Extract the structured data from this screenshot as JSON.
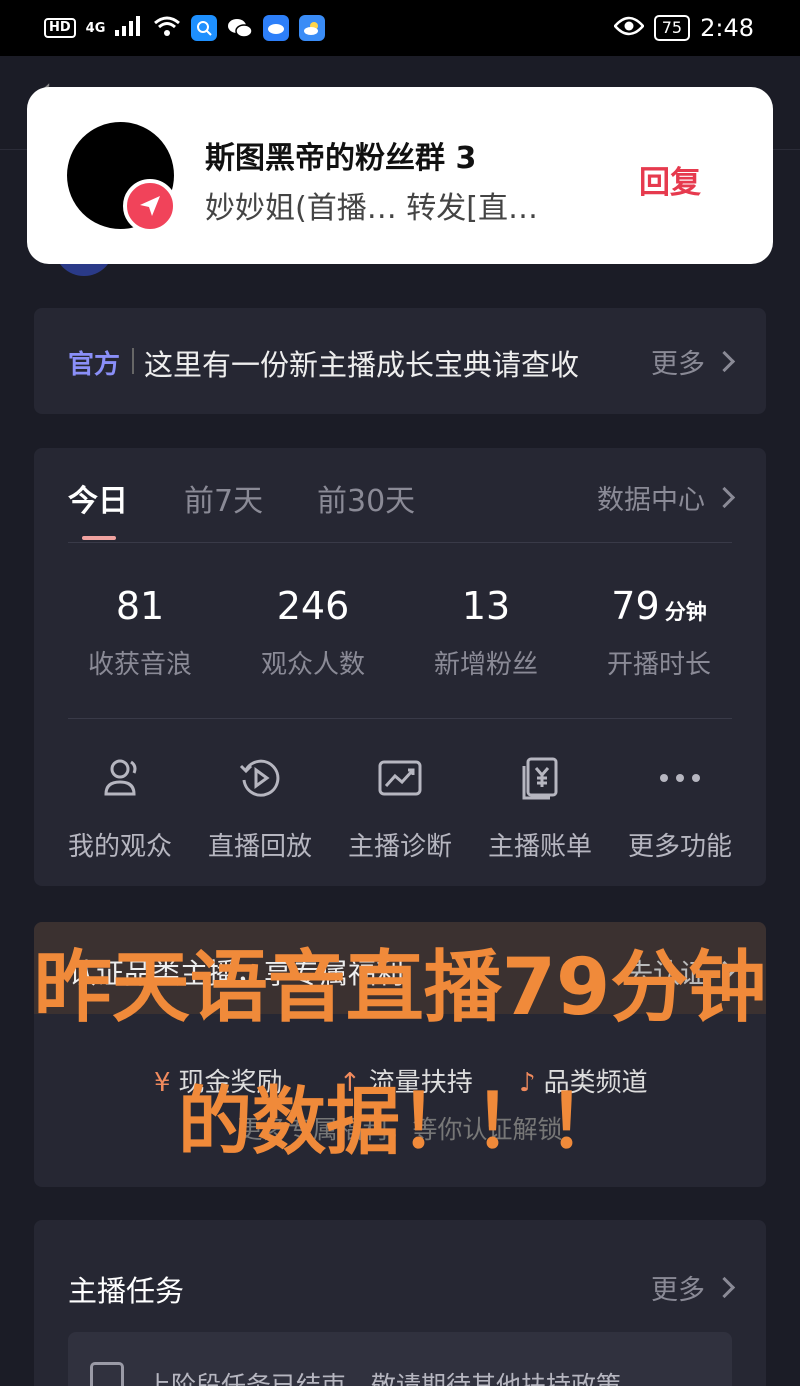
{
  "status_bar": {
    "hd": "HD",
    "network": "4G",
    "battery": "75",
    "time": "2:48"
  },
  "notification": {
    "title": "斯图黑帝的粉丝群 3",
    "message": "妙妙姐(首播… 转发[直…",
    "reply_label": "回复"
  },
  "official": {
    "tag": "官方",
    "text": "这里有一份新主播成长宝典请查收",
    "more_label": "更多"
  },
  "stats": {
    "tabs": [
      "今日",
      "前7天",
      "前30天"
    ],
    "data_center_label": "数据中心",
    "items": [
      {
        "value": "81",
        "unit": "",
        "label": "收获音浪"
      },
      {
        "value": "246",
        "unit": "",
        "label": "观众人数"
      },
      {
        "value": "13",
        "unit": "",
        "label": "新增粉丝"
      },
      {
        "value": "79",
        "unit": "分钟",
        "label": "开播时长"
      }
    ],
    "tools": [
      {
        "label": "我的观众",
        "icon": "audience-icon"
      },
      {
        "label": "直播回放",
        "icon": "replay-icon"
      },
      {
        "label": "主播诊断",
        "icon": "diagnosis-icon"
      },
      {
        "label": "主播账单",
        "icon": "bill-icon"
      },
      {
        "label": "更多功能",
        "icon": "more-dots-icon"
      }
    ]
  },
  "certification": {
    "title": "认证品类主播，享专属福利",
    "link_label": "去认证",
    "perks": [
      "现金奖励",
      "流量扶持",
      "品类频道"
    ],
    "subtitle": "更多专属福利，等你认证解锁"
  },
  "overlay": {
    "line1": "昨天语音直播79分钟",
    "line2": "的数据！！！"
  },
  "tasks": {
    "title": "主播任务",
    "more_label": "更多",
    "note": "上阶段任务已结束，敬请期待其他扶持政策"
  },
  "colors": {
    "background": "#1b1c26",
    "card": "#262733",
    "accent_reply": "#e63a4e",
    "official_tag": "#8a8ff8",
    "overlay_text": "#f08a3a"
  }
}
